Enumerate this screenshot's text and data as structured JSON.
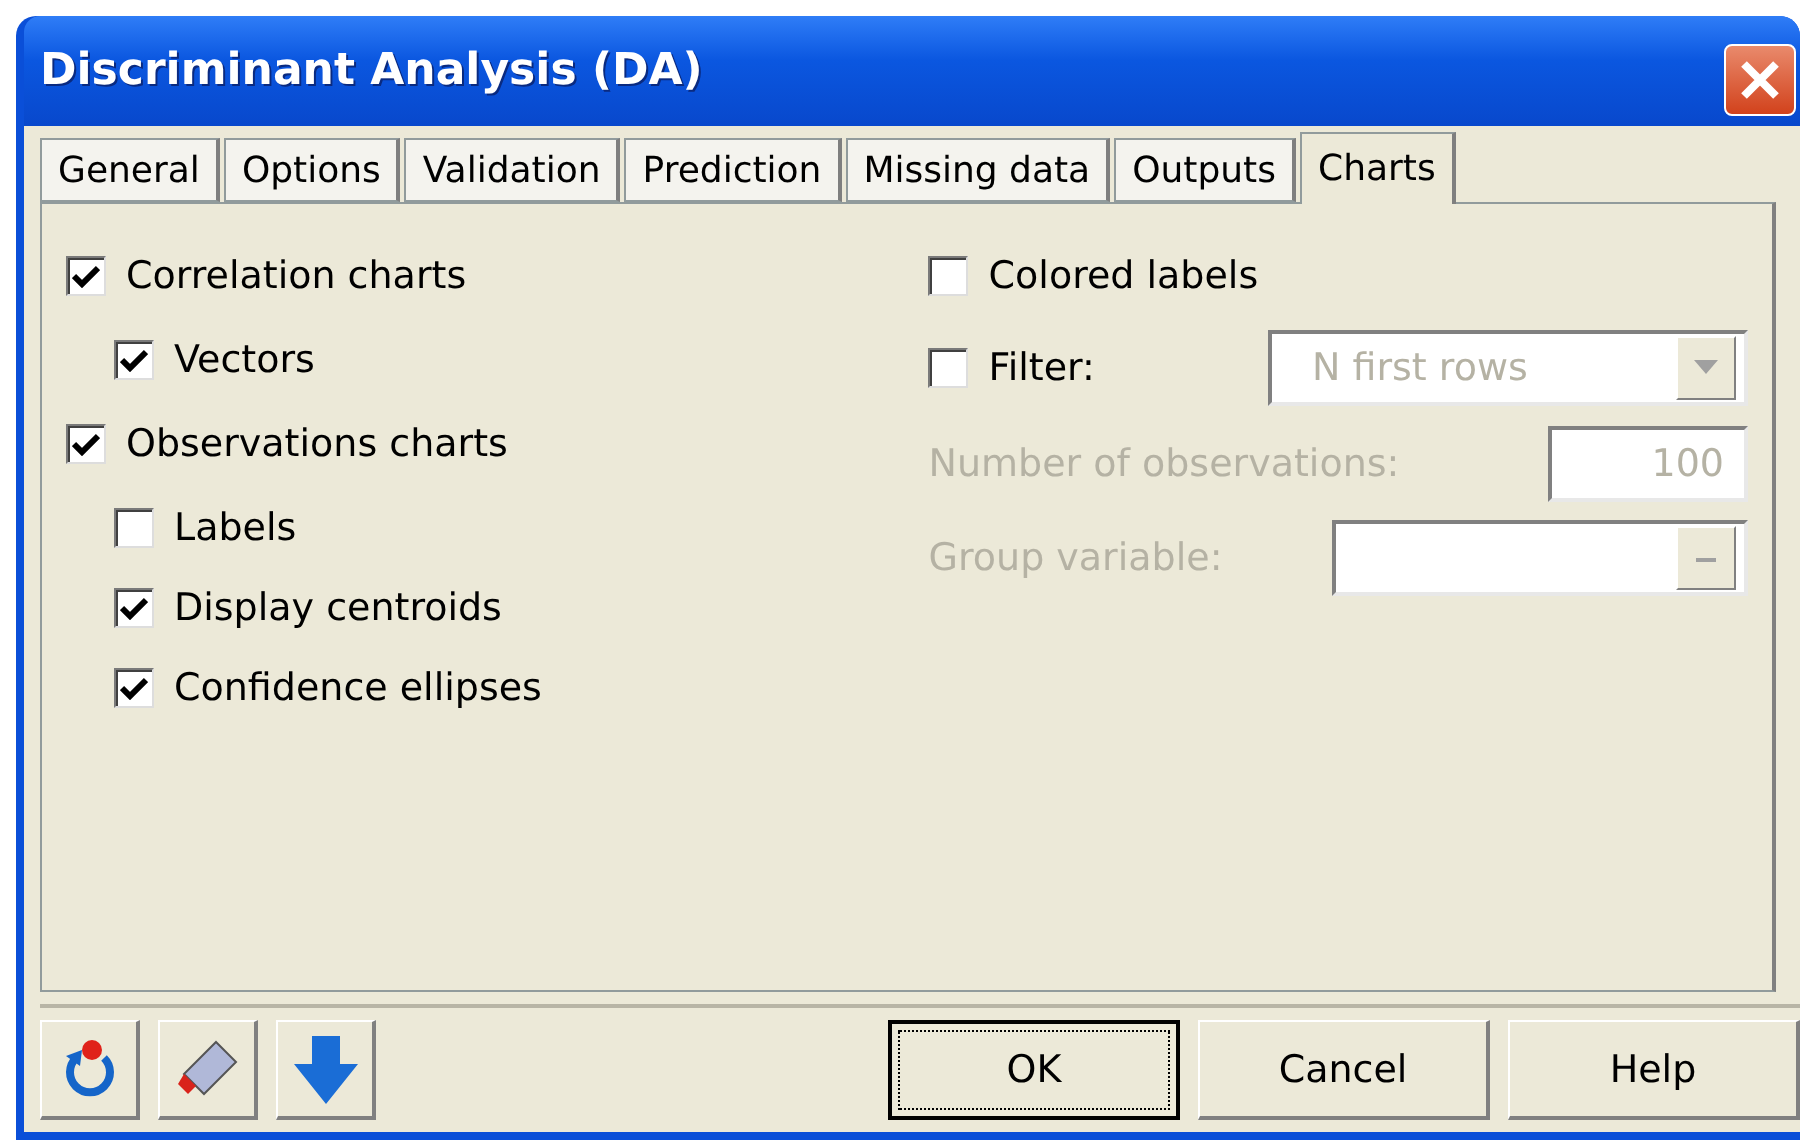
{
  "window": {
    "title": "Discriminant Analysis (DA)"
  },
  "tabs": [
    {
      "label": "General",
      "selected": false
    },
    {
      "label": "Options",
      "selected": false
    },
    {
      "label": "Validation",
      "selected": false
    },
    {
      "label": "Prediction",
      "selected": false
    },
    {
      "label": "Missing data",
      "selected": false
    },
    {
      "label": "Outputs",
      "selected": false
    },
    {
      "label": "Charts",
      "selected": true
    }
  ],
  "left_options": [
    {
      "label": "Correlation charts",
      "checked": true,
      "children": [
        {
          "label": "Vectors",
          "checked": true
        }
      ]
    },
    {
      "label": "Observations charts",
      "checked": true,
      "children": [
        {
          "label": "Labels",
          "checked": false
        },
        {
          "label": "Display centroids",
          "checked": true
        },
        {
          "label": "Confidence ellipses",
          "checked": true
        }
      ]
    }
  ],
  "colored_labels": {
    "label": "Colored labels",
    "checked": false
  },
  "filter": {
    "label": "Filter:",
    "checked": false,
    "value": "N first rows",
    "disabled": true
  },
  "number_of_observations": {
    "label": "Number of observations:",
    "value": "100",
    "disabled": true
  },
  "group_variable": {
    "label": "Group variable:",
    "disabled": true
  },
  "buttons": [
    {
      "label": "OK",
      "default": true
    },
    {
      "label": "Cancel",
      "default": false
    },
    {
      "label": "Help",
      "default": false
    }
  ]
}
